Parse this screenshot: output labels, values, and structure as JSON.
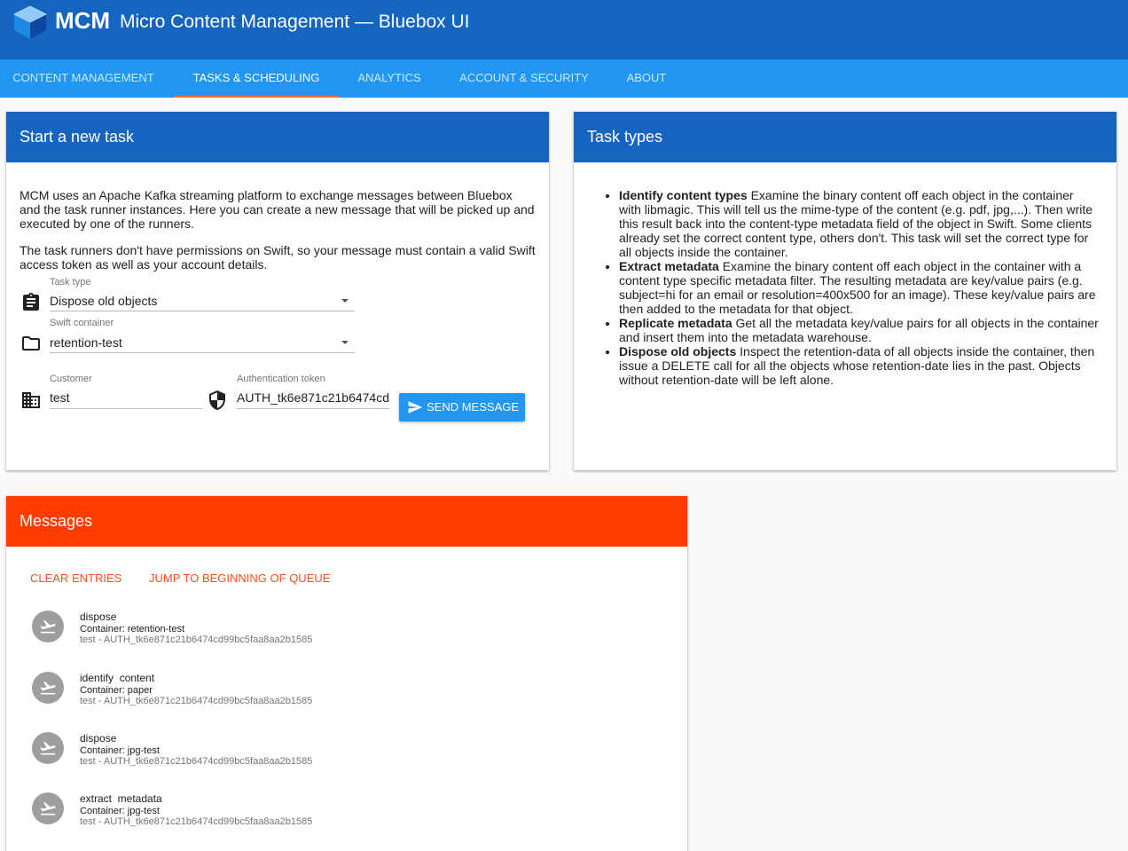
{
  "app": {
    "brand": "MCM",
    "title": "Micro Content Management — Bluebox UI",
    "colors": {
      "header": "#1565c0",
      "tabs": "#2196f3",
      "accent": "#ff3d00",
      "tab_indicator": "#ff7043"
    }
  },
  "tabs": [
    {
      "label": "CONTENT MANAGEMENT",
      "active": false
    },
    {
      "label": "TASKS & SCHEDULING",
      "active": true
    },
    {
      "label": "ANALYTICS",
      "active": false
    },
    {
      "label": "ACCOUNT & SECURITY",
      "active": false
    },
    {
      "label": "ABOUT",
      "active": false
    }
  ],
  "new_task": {
    "title": "Start a new task",
    "intro1": "MCM uses an Apache Kafka streaming platform to exchange messages between Bluebox and the task runner instances. Here you can create a new message that will be picked up and executed by one of the runners.",
    "intro2": "The task runners don't have permissions on Swift, so your message must contain a valid Swift access token as well as your account details.",
    "task_type": {
      "label": "Task type",
      "value": "Dispose old objects",
      "icon": "clipboard-icon"
    },
    "container": {
      "label": "Swift container",
      "value": "retention-test",
      "icon": "folder-icon"
    },
    "customer": {
      "label": "Customer",
      "value": "test",
      "icon": "building-icon"
    },
    "token": {
      "label": "Authentication token",
      "value": "AUTH_tk6e871c21b6474cd",
      "icon": "shield-icon"
    },
    "send_label": "SEND MESSAGE"
  },
  "task_types": {
    "title": "Task types",
    "items": [
      {
        "name": "Identify content types",
        "desc": "Examine the binary content off each object in the container with libmagic. This will tell us the mime-type of the content (e.g. pdf, jpg,...). Then write this result back into the content-type metadata field of the object in Swift. Some clients already set the correct content type, others don't. This task will set the correct type for all objects inside the container."
      },
      {
        "name": "Extract metadata",
        "desc": "Examine the binary content off each object in the container with a content type specific metadata filter. The resulting metadata are key/value pairs (e.g. subject=hi for an email or resolution=400x500 for an image). These key/value pairs are then added to the metadata for that object."
      },
      {
        "name": "Replicate metadata",
        "desc": "Get all the metadata key/value pairs for all objects in the container and insert them into the metadata warehouse."
      },
      {
        "name": "Dispose old objects",
        "desc": "Inspect the retention-data of all objects inside the container, then issue a DELETE call for all the objects whose retention-date lies in the past. Objects without retention-date will be left alone."
      }
    ]
  },
  "messages": {
    "title": "Messages",
    "clear_label": "CLEAR ENTRIES",
    "jump_label": "JUMP TO BEGINNING OF QUEUE",
    "items": [
      {
        "title": "dispose",
        "container": "Container: retention-test",
        "meta": "test - AUTH_tk6e871c21b6474cd99bc5faa8aa2b1585"
      },
      {
        "title": "identify  content",
        "container": "Container: paper",
        "meta": "test - AUTH_tk6e871c21b6474cd99bc5faa8aa2b1585"
      },
      {
        "title": "dispose",
        "container": "Container: jpg-test",
        "meta": "test - AUTH_tk6e871c21b6474cd99bc5faa8aa2b1585"
      },
      {
        "title": "extract  metadata",
        "container": "Container: jpg-test",
        "meta": "test - AUTH_tk6e871c21b6474cd99bc5faa8aa2b1585"
      }
    ]
  }
}
